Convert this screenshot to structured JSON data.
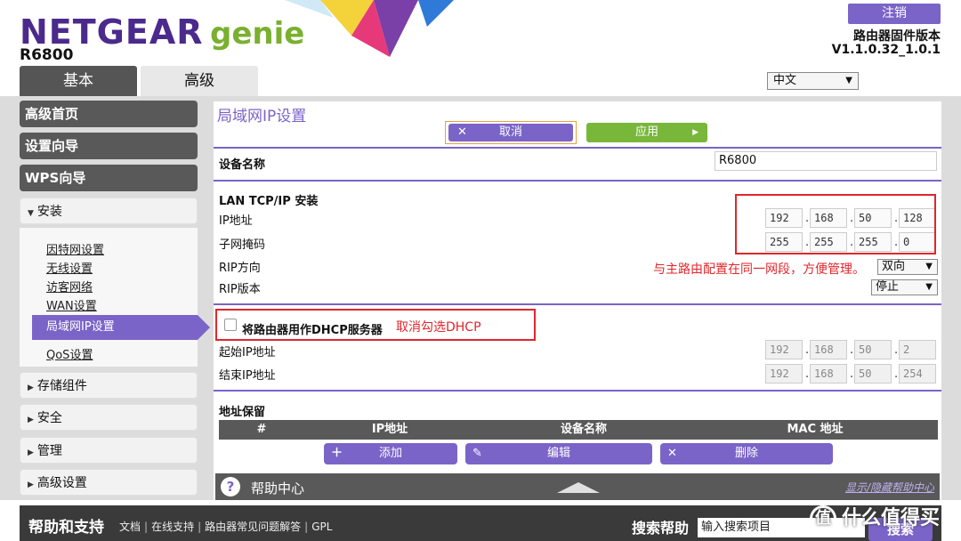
{
  "header": {
    "logo_brand": "NETGEAR",
    "logo_product": "genie",
    "model": "R6800",
    "logout_label": "注销",
    "firmware_label": "路由器固件版本",
    "firmware_version": "V1.1.0.32_1.0.1"
  },
  "tabs": [
    {
      "label": "基本",
      "active": false
    },
    {
      "label": "高级",
      "active": true
    }
  ],
  "language": {
    "selected": "中文"
  },
  "sidebar": {
    "items": [
      {
        "label": "高级首页"
      },
      {
        "label": "设置向导"
      },
      {
        "label": "WPS向导"
      }
    ],
    "setup_section": "安装",
    "setup_sub": [
      {
        "label": "因特网设置"
      },
      {
        "label": "无线设置"
      },
      {
        "label": "访客网络"
      },
      {
        "label": "WAN设置"
      },
      {
        "label": "局域网IP设置"
      },
      {
        "label": "QoS设置"
      }
    ],
    "collapsed": [
      {
        "label": "存储组件"
      },
      {
        "label": "安全"
      },
      {
        "label": "管理"
      },
      {
        "label": "高级设置"
      }
    ]
  },
  "main": {
    "title": "局域网IP设置",
    "cancel_label": "取消",
    "apply_label": "应用",
    "device_name_label": "设备名称",
    "device_name_value": "R6800",
    "lan_section": "LAN TCP/IP 安装",
    "ip_label": "IP地址",
    "ip": [
      "192",
      "168",
      "50",
      "128"
    ],
    "subnet_label": "子网掩码",
    "subnet": [
      "255",
      "255",
      "255",
      "0"
    ],
    "rip_dir_label": "RIP方向",
    "rip_dir_value": "双向",
    "rip_ver_label": "RIP版本",
    "rip_ver_value": "停止",
    "dhcp_checkbox_label": "将路由器用作DHCP服务器",
    "dhcp_checked": false,
    "start_ip_label": "起始IP地址",
    "start_ip": [
      "192",
      "168",
      "50",
      "2"
    ],
    "end_ip_label": "结束IP地址",
    "end_ip": [
      "192",
      "168",
      "50",
      "254"
    ],
    "reservation_title": "地址保留",
    "reservation_columns": [
      "#",
      "IP地址",
      "设备名称",
      "MAC 地址"
    ],
    "add_label": "添加",
    "edit_label": "编辑",
    "delete_label": "删除"
  },
  "annotations": {
    "note_ip": "与主路由配置在同一网段，方便管理。",
    "note_dhcp": "取消勾选DHCP",
    "color": "#e0262c"
  },
  "help": {
    "title": "帮助中心",
    "toggle": "显示/隐藏帮助中心"
  },
  "footer": {
    "title": "帮助和支持",
    "links": [
      "文档",
      "在线支持",
      "路由器常见问题解答",
      "GPL"
    ],
    "search_label": "搜索帮助",
    "search_placeholder": "输入搜索项目",
    "search_button": "搜索"
  },
  "watermark": {
    "glyph": "值",
    "text": "什么值得买"
  },
  "colors": {
    "accent": "#7b64c8",
    "apply_green": "#79b73b",
    "dark_gray": "#595959"
  }
}
